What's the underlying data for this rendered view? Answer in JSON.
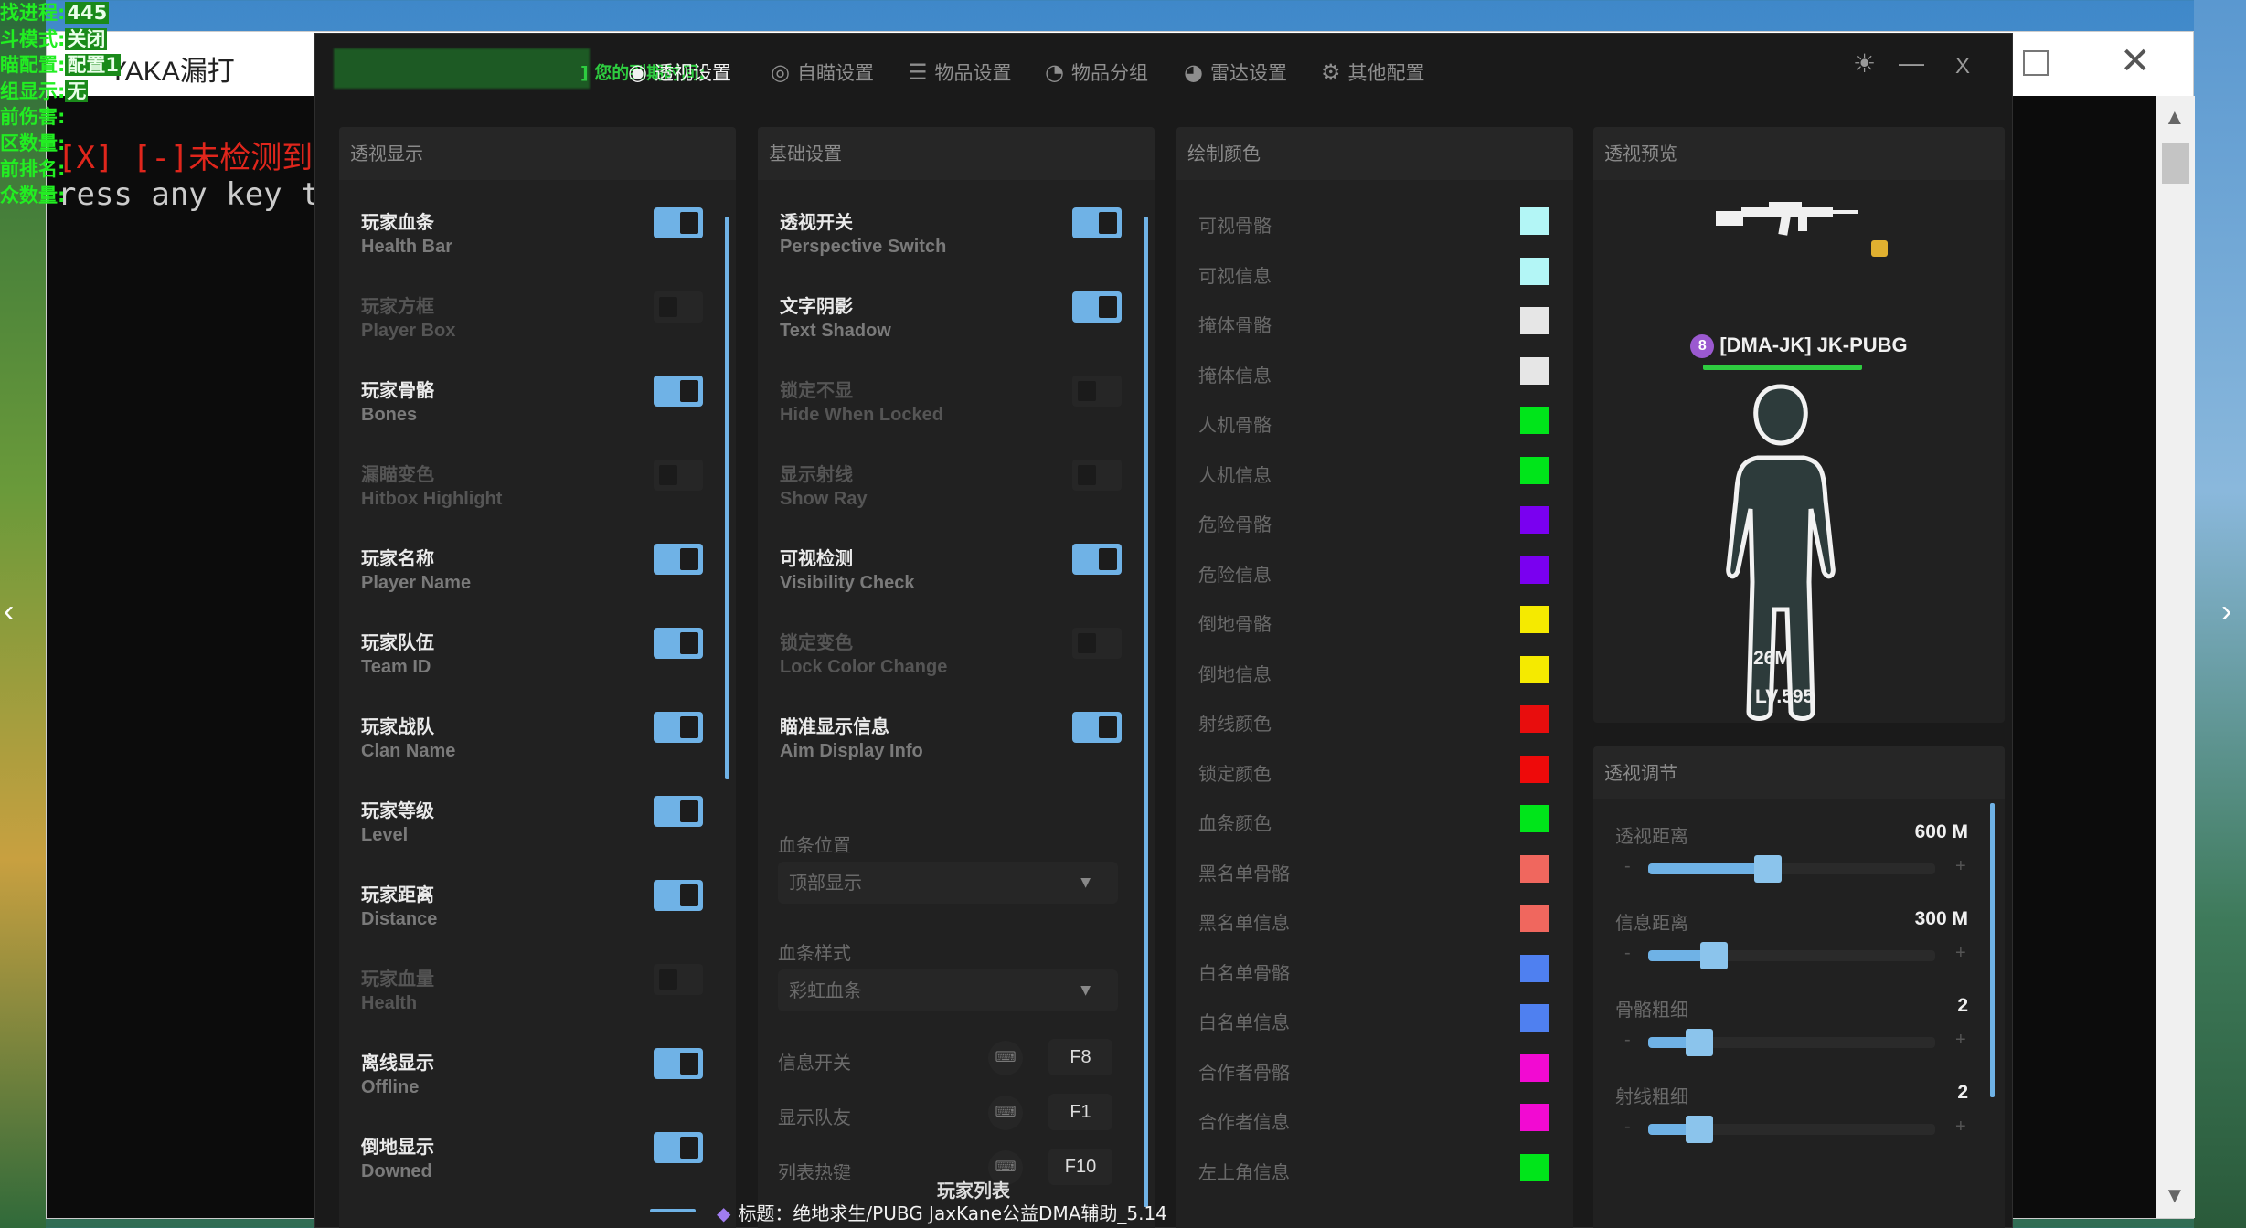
{
  "console": {
    "title": "YAKA漏打",
    "lines": [
      "[X] [-]未检测到",
      "ress any key to"
    ],
    "line_colors": [
      "#e0261c",
      "#cccccc"
    ]
  },
  "overlay": {
    "lines": [
      {
        "label": "找进程:",
        "value": "445"
      },
      {
        "label": "斗模式:",
        "value": "关闭"
      },
      {
        "label": "瞄配置:",
        "value": "配置1"
      },
      {
        "label": "组显示:",
        "value": "无"
      },
      {
        "label": "前伤害:",
        "value": ""
      },
      {
        "label": "区数量:",
        "value": ""
      },
      {
        "label": "前排名:",
        "value": ""
      },
      {
        "label": "众数量:",
        "value": ""
      }
    ]
  },
  "app": {
    "expiry_label": "] 您的到期时间:",
    "nav": [
      {
        "icon": "eye-icon",
        "glyph": "◉",
        "label": "透视设置",
        "active": true
      },
      {
        "icon": "crosshair-icon",
        "glyph": "◎",
        "label": "自瞄设置",
        "active": false
      },
      {
        "icon": "sliders-icon",
        "glyph": "☰",
        "label": "物品设置",
        "active": false
      },
      {
        "icon": "gauge-icon",
        "glyph": "◔",
        "label": "物品分组",
        "active": false
      },
      {
        "icon": "radar-icon",
        "glyph": "◕",
        "label": "雷达设置",
        "active": false
      },
      {
        "icon": "gear-icon",
        "glyph": "⚙",
        "label": "其他配置",
        "active": false
      }
    ],
    "controls": {
      "theme": "☀",
      "minimize": "—",
      "close": "X"
    }
  },
  "display_panel": {
    "title": "透视显示",
    "items": [
      {
        "zh": "玩家血条",
        "en": "Health Bar",
        "on": true
      },
      {
        "zh": "玩家方框",
        "en": "Player Box",
        "on": false
      },
      {
        "zh": "玩家骨骼",
        "en": "Bones",
        "on": true
      },
      {
        "zh": "漏瞄变色",
        "en": "Hitbox Highlight",
        "on": false
      },
      {
        "zh": "玩家名称",
        "en": "Player Name",
        "on": true
      },
      {
        "zh": "玩家队伍",
        "en": "Team ID",
        "on": true
      },
      {
        "zh": "玩家战队",
        "en": "Clan Name",
        "on": true
      },
      {
        "zh": "玩家等级",
        "en": "Level",
        "on": true
      },
      {
        "zh": "玩家距离",
        "en": "Distance",
        "on": true
      },
      {
        "zh": "玩家血量",
        "en": "Health",
        "on": false
      },
      {
        "zh": "离线显示",
        "en": "Offline",
        "on": true
      },
      {
        "zh": "倒地显示",
        "en": "Downed",
        "on": true
      }
    ]
  },
  "basic_panel": {
    "title": "基础设置",
    "items": [
      {
        "zh": "透视开关",
        "en": "Perspective Switch",
        "on": true
      },
      {
        "zh": "文字阴影",
        "en": "Text Shadow",
        "on": true
      },
      {
        "zh": "锁定不显",
        "en": "Hide When Locked",
        "on": false
      },
      {
        "zh": "显示射线",
        "en": "Show Ray",
        "on": false
      },
      {
        "zh": "可视检测",
        "en": "Visibility Check",
        "on": true
      },
      {
        "zh": "锁定变色",
        "en": "Lock Color Change",
        "on": false
      },
      {
        "zh": "瞄准显示信息",
        "en": "Aim Display Info",
        "on": true
      }
    ],
    "hp_position": {
      "label": "血条位置",
      "value": "顶部显示"
    },
    "hp_style": {
      "label": "血条样式",
      "value": "彩虹血条"
    },
    "hotkeys": [
      {
        "label": "信息开关",
        "key": "F8"
      },
      {
        "label": "显示队友",
        "key": "F1"
      },
      {
        "label": "列表热键",
        "key": "F10"
      }
    ],
    "player_list_label": "玩家列表"
  },
  "color_panel": {
    "title": "绘制颜色",
    "items": [
      {
        "name": "可视骨骼",
        "color": "#b3f6f6"
      },
      {
        "name": "可视信息",
        "color": "#b3f6f6"
      },
      {
        "name": "掩体骨骼",
        "color": "#e6e6e6"
      },
      {
        "name": "掩体信息",
        "color": "#e6e6e6"
      },
      {
        "name": "人机骨骼",
        "color": "#00e51a"
      },
      {
        "name": "人机信息",
        "color": "#00e51a"
      },
      {
        "name": "危险骨骼",
        "color": "#7a00f0"
      },
      {
        "name": "危险信息",
        "color": "#7a00f0"
      },
      {
        "name": "倒地骨骼",
        "color": "#f5ea00"
      },
      {
        "name": "倒地信息",
        "color": "#f5ea00"
      },
      {
        "name": "射线颜色",
        "color": "#e80d0d"
      },
      {
        "name": "锁定颜色",
        "color": "#ee0a0a"
      },
      {
        "name": "血条颜色",
        "color": "#00e51a"
      },
      {
        "name": "黑名单骨骼",
        "color": "#f0675e"
      },
      {
        "name": "黑名单信息",
        "color": "#f0675e"
      },
      {
        "name": "白名单骨骼",
        "color": "#4f80f0"
      },
      {
        "name": "白名单信息",
        "color": "#4f80f0"
      },
      {
        "name": "合作者骨骼",
        "color": "#f20ad2"
      },
      {
        "name": "合作者信息",
        "color": "#f20ad2"
      },
      {
        "name": "左上角信息",
        "color": "#00e51a"
      }
    ]
  },
  "preview_panel": {
    "title": "透视预览",
    "badge": "8",
    "player_name": "[DMA-JK] JK-PUBG",
    "distance": "26M",
    "level": "LV.595"
  },
  "adjust_panel": {
    "title": "透视调节",
    "sliders": [
      {
        "name": "透视距离",
        "value": "600 M",
        "fraction": 0.39
      },
      {
        "name": "信息距离",
        "value": "300 M",
        "fraction": 0.2
      },
      {
        "name": "骨骼粗细",
        "value": "2",
        "fraction": 0.15
      },
      {
        "name": "射线粗细",
        "value": "2",
        "fraction": 0.15
      }
    ],
    "minus": "-",
    "plus": "+"
  },
  "caption": "标题：绝地求生/PUBG JaxKane公益DMA辅助_5.14"
}
